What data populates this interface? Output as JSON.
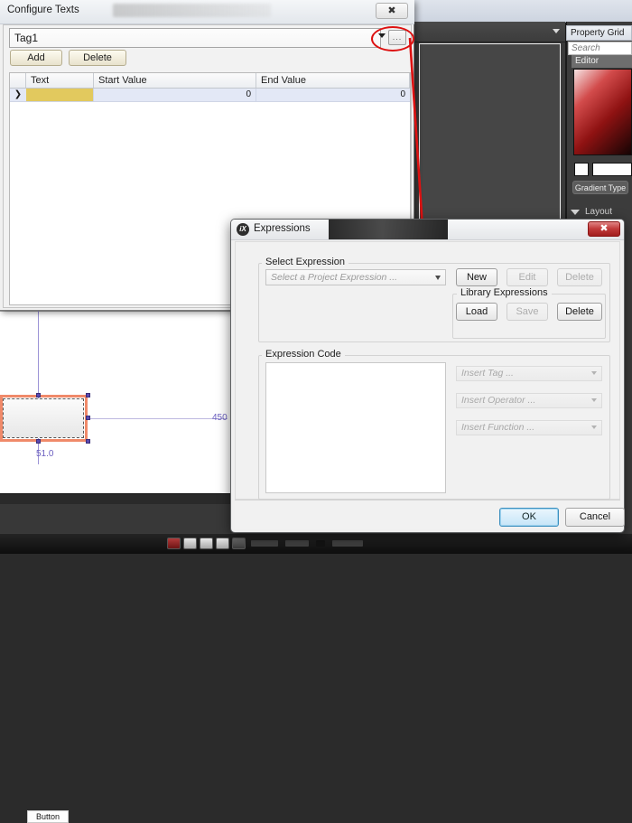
{
  "background": {
    "property_grid": {
      "title": "Property Grid",
      "search_placeholder": "Search",
      "editor_section": "Editor",
      "gradient_type_label": "Gradient Type",
      "layout_section": "Layout",
      "accent_color": "#c23b3b"
    }
  },
  "canvas": {
    "button_label": "Button",
    "measure_horizontal": "450",
    "measure_vertical": "51.0",
    "selection_color": "#f08a6a",
    "guide_color": "#6b5fc0"
  },
  "configure_texts_dialog": {
    "title": "Configure Texts",
    "close_label": "✖",
    "tag_value": "Tag1",
    "tag_ellipsis_label": "...",
    "add_label": "Add",
    "delete_label": "Delete",
    "grid": {
      "columns": [
        "",
        "Text",
        "Start Value",
        "End Value"
      ],
      "rows": [
        {
          "indicator": "❯",
          "text": "",
          "start_value": "0",
          "end_value": "0"
        }
      ]
    },
    "annotation_color": "#dd1111"
  },
  "expressions_dialog": {
    "icon_label": "iX",
    "title": "Expressions",
    "close_label": "✖",
    "select_expression_group": "Select Expression",
    "expression_combo_placeholder": "Select a Project Expression ...",
    "new_label": "New",
    "edit_label": "Edit",
    "delete_label": "Delete",
    "library_expressions_group": "Library Expressions",
    "load_label": "Load",
    "save_label": "Save",
    "library_delete_label": "Delete",
    "expression_code_group": "Expression Code",
    "code_value": "",
    "insert_tag_placeholder": "Insert Tag ...",
    "insert_operator_placeholder": "Insert Operator ...",
    "insert_function_placeholder": "Insert Function ...",
    "ok_label": "OK",
    "cancel_label": "Cancel"
  }
}
